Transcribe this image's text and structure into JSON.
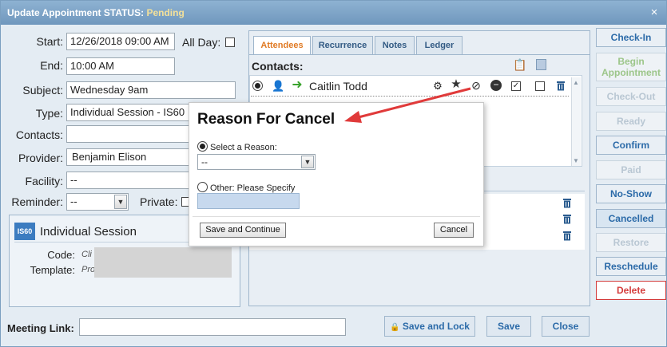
{
  "window": {
    "title_prefix": "Update Appointment STATUS:",
    "status": "Pending",
    "close_glyph": "×"
  },
  "form": {
    "start_label": "Start:",
    "start_value": "12/26/2018 09:00 AM",
    "all_day_label": "All Day:",
    "end_label": "End:",
    "end_value": "10:00 AM",
    "subject_label": "Subject:",
    "subject_value": "Wednesday 9am",
    "type_label": "Type:",
    "type_value": "Individual Session - IS60",
    "contacts_label": "Contacts:",
    "contacts_value": "",
    "provider_label": "Provider:",
    "provider_value": "Benjamin Elison",
    "facility_label": "Facility:",
    "facility_value": "--",
    "reminder_label": "Reminder:",
    "reminder_value": "--",
    "private_label": "Private:"
  },
  "session_card": {
    "badge": "IS60",
    "title": "Individual Session",
    "code_label": "Code:",
    "code_value": "Cli",
    "template_label": "Template:",
    "template_value": "Pro"
  },
  "tabs": [
    {
      "label": "Attendees"
    },
    {
      "label": "Recurrence"
    },
    {
      "label": "Notes"
    },
    {
      "label": "Ledger"
    }
  ],
  "attendees": {
    "contacts_header": "Contacts:",
    "rows": [
      {
        "name": "Caitlin Todd"
      }
    ]
  },
  "right_buttons": [
    {
      "label": "Check-In",
      "state": "enabled"
    },
    {
      "label": "Begin Appointment",
      "state": "disabled-green"
    },
    {
      "label": "Check-Out",
      "state": "disabled"
    },
    {
      "label": "Ready",
      "state": "disabled"
    },
    {
      "label": "Confirm",
      "state": "enabled"
    },
    {
      "label": "Paid",
      "state": "disabled"
    },
    {
      "label": "No-Show",
      "state": "enabled"
    },
    {
      "label": "Cancelled",
      "state": "active"
    },
    {
      "label": "Restore",
      "state": "disabled"
    },
    {
      "label": "Reschedule",
      "state": "enabled"
    },
    {
      "label": "Delete",
      "state": "danger"
    }
  ],
  "footer": {
    "meeting_link_label": "Meeting Link:",
    "meeting_link_value": "",
    "save_lock_label": "Save and Lock",
    "save_label": "Save",
    "close_label": "Close"
  },
  "modal": {
    "title": "Reason For Cancel",
    "select_reason_label": "Select a Reason:",
    "select_reason_value": "--",
    "other_label": "Other: Please Specify",
    "other_value": "",
    "save_continue_label": "Save and Continue",
    "cancel_label": "Cancel"
  },
  "colors": {
    "titlebar": "#7aa3c8",
    "status_text": "#f4e19a",
    "accent_blue": "#2b6aa8",
    "delete_red": "#d43c3c",
    "arrow_red": "#e03a3a",
    "active_tab_text": "#e07a24"
  }
}
